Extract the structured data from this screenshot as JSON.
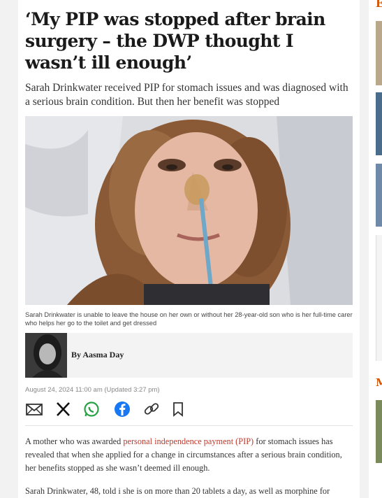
{
  "headline": "‘My PIP was stopped after brain surgery – the DWP thought I wasn’t ill enough’",
  "standfirst": "Sarah Drinkwater received PIP for stomach issues and was diagnosed with a serious brain condition. But then her benefit was stopped",
  "hero_caption": "Sarah Drinkwater is unable to leave the house on her own or without her 28-year-old son who is her full-time carer who helps her go to the toilet and get dressed",
  "byline": "By Aasma Day",
  "dateline": "August 24, 2024 11:00 am  (Updated 3:27 pm)",
  "share_icons": [
    "email-icon",
    "x-icon",
    "whatsapp-icon",
    "facebook-icon",
    "link-icon",
    "bookmark-icon"
  ],
  "paragraph1": {
    "before": "A mother who was awarded ",
    "link": "personal independence payment (PIP)",
    "after": " for stomach issues has revealed that when she applied for a change in circumstances after a serious brain condition, her benefits stopped as she wasn’t deemed ill enough."
  },
  "paragraph2": "Sarah Drinkwater, 48, told i she is on more than 20 tablets a day, as well as morphine for",
  "rail": {
    "letter_top": "E",
    "letter_mid": "M"
  },
  "colors": {
    "accent_link": "#c0392b",
    "rail_accent": "#d35400",
    "whatsapp": "#25a244",
    "facebook": "#1877f2"
  }
}
